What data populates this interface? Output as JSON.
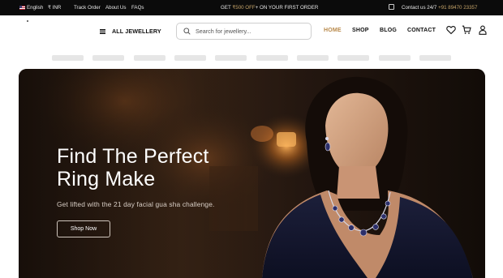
{
  "topbar": {
    "language": "English",
    "currency": "₹ INR",
    "links": [
      "Track Order",
      "About Us",
      "FAQs"
    ],
    "promo_prefix": "GET ",
    "promo_highlight": "₹500 OFF",
    "promo_suffix": "+ ON YOUR FIRST ORDER",
    "contact_label": "Contact us 24/7",
    "contact_phone": "+91 89470 23357"
  },
  "header": {
    "menu_label": "ALL JEWELLERY",
    "search_placeholder": "Search for jewellery...",
    "nav": [
      {
        "label": "HOME",
        "active": true
      },
      {
        "label": "SHOP",
        "active": false
      },
      {
        "label": "BLOG",
        "active": false
      },
      {
        "label": "CONTACT",
        "active": false
      }
    ],
    "icons": [
      "heart-icon",
      "cart-icon",
      "user-icon"
    ]
  },
  "hero": {
    "title": "Find The Perfect Ring Make",
    "subtitle": "Get lifted with the 21 day facial gua sha challenge.",
    "button_label": "Shop Now"
  },
  "colors": {
    "accent": "#c7a56a",
    "nav_active": "#b8894a",
    "topbar_bg": "#0b0b0b"
  }
}
